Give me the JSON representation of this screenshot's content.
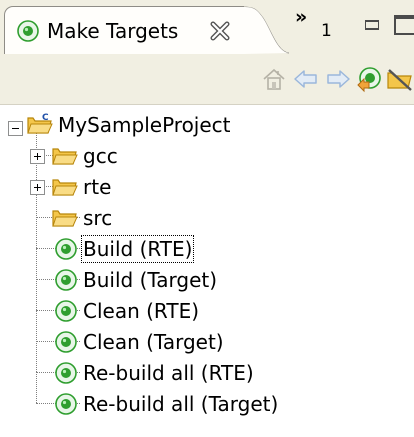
{
  "view_tab": {
    "title": "Make Targets",
    "icon": "make-target-icon",
    "close_icon": "close-icon"
  },
  "overflow": {
    "chevron": "»",
    "count": "1"
  },
  "window_controls": [
    "minimize-icon",
    "maximize-icon"
  ],
  "toolbar": {
    "buttons": [
      "home-icon",
      "back-arrow-icon",
      "forward-arrow-icon",
      "build-target-icon",
      "hide-folders-icon"
    ]
  },
  "tree": {
    "project": "MySampleProject",
    "folders": [
      "gcc",
      "rte",
      "src"
    ],
    "targets": [
      "Build (RTE)",
      "Build (Target)",
      "Clean (RTE)",
      "Clean (Target)",
      "Re-build all (RTE)",
      "Re-build all (Target)"
    ],
    "selected_target": "Build (RTE)"
  },
  "colors": {
    "chrome": "#f1efe2",
    "target_green": "#2f9e2f",
    "folder_yellow": "#f4c64a",
    "arrow_blue": "#9bb7db"
  }
}
